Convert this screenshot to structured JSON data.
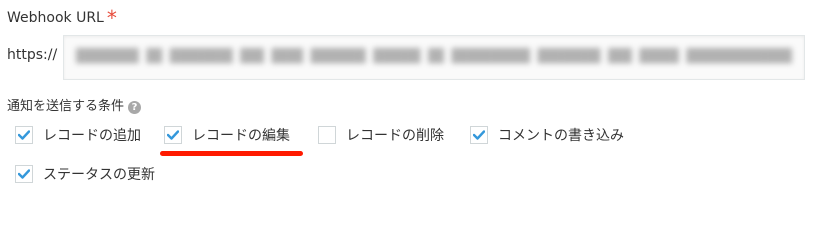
{
  "webhook": {
    "label": "Webhook URL",
    "required_mark": "*",
    "url_prefix": "https://",
    "url_value_redacted": "████████ ██ ████████ ███ ████ ███████ ██████ ██ ██████████ ████████ ███ █████ ██████████████ ████ ███████ █████ ██████ ███"
  },
  "conditions": {
    "label": "通知を送信する条件",
    "help_icon": "question-circle-icon",
    "options": [
      {
        "label": "レコードの追加",
        "checked": true
      },
      {
        "label": "レコードの編集",
        "checked": true
      },
      {
        "label": "レコードの削除",
        "checked": false
      },
      {
        "label": "コメントの書き込み",
        "checked": true
      },
      {
        "label": "ステータスの更新",
        "checked": true
      }
    ]
  },
  "colors": {
    "check": "#3498db",
    "required": "#e74c3c",
    "annotation": "#ff1a00"
  }
}
